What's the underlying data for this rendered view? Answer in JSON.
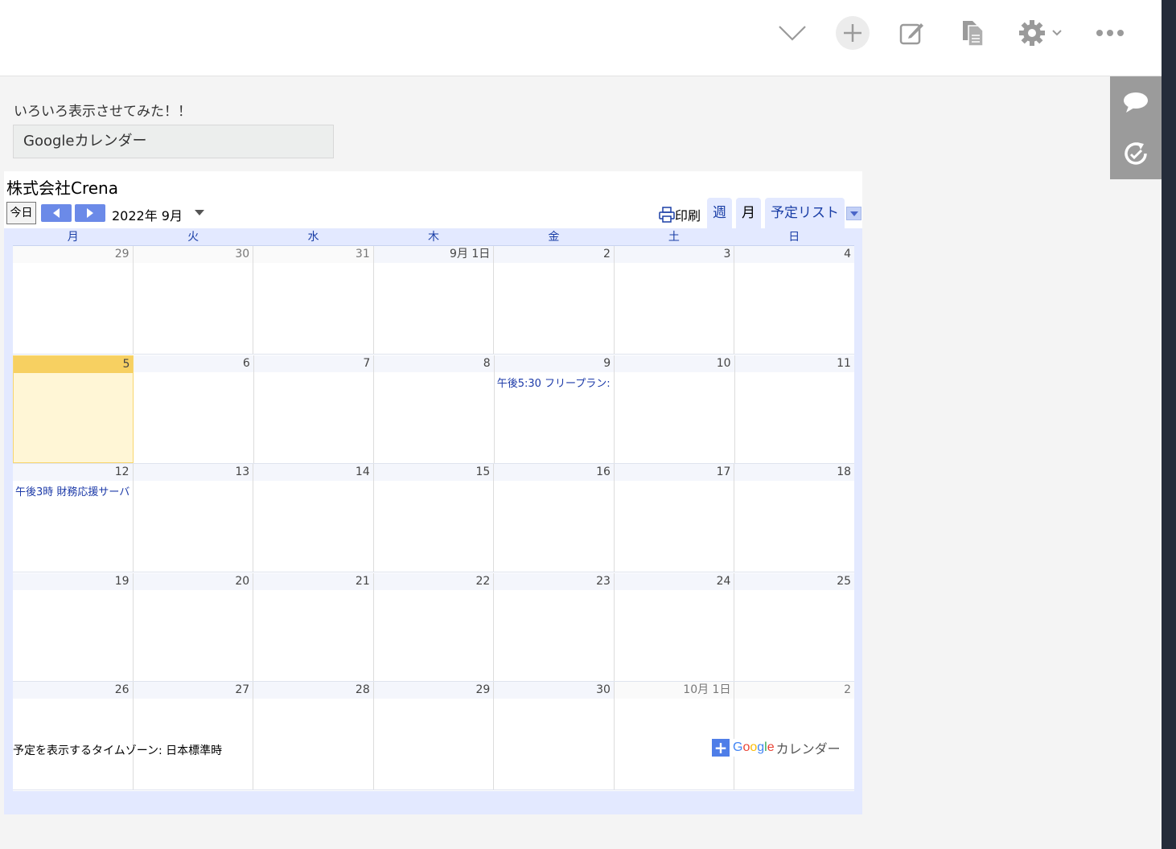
{
  "intro_text": "いろいろ表示させてみた！！",
  "label_box": "Googleカレンダー",
  "calendar": {
    "title": "株式会社Crena",
    "today_button": "今日",
    "month_label": "2022年 9月",
    "print_label": "印刷",
    "views": {
      "week": "週",
      "month": "月",
      "list": "予定リスト"
    },
    "weekdays": [
      "月",
      "火",
      "水",
      "木",
      "金",
      "土",
      "日"
    ],
    "weeks": [
      [
        {
          "label": "29",
          "other": true
        },
        {
          "label": "30",
          "other": true
        },
        {
          "label": "31",
          "other": true
        },
        {
          "label": "9月 1日",
          "other": false
        },
        {
          "label": "2",
          "other": false
        },
        {
          "label": "3",
          "other": false
        },
        {
          "label": "4",
          "other": false
        }
      ],
      [
        {
          "label": "5",
          "other": false,
          "today": true
        },
        {
          "label": "6",
          "other": false
        },
        {
          "label": "7",
          "other": false
        },
        {
          "label": "8",
          "other": false
        },
        {
          "label": "9",
          "other": false,
          "event": "午後5:30 フリープラン:"
        },
        {
          "label": "10",
          "other": false
        },
        {
          "label": "11",
          "other": false
        }
      ],
      [
        {
          "label": "12",
          "other": false,
          "event": "午後3時 財務応援サーバ"
        },
        {
          "label": "13",
          "other": false
        },
        {
          "label": "14",
          "other": false
        },
        {
          "label": "15",
          "other": false
        },
        {
          "label": "16",
          "other": false
        },
        {
          "label": "17",
          "other": false
        },
        {
          "label": "18",
          "other": false
        }
      ],
      [
        {
          "label": "19",
          "other": false
        },
        {
          "label": "20",
          "other": false
        },
        {
          "label": "21",
          "other": false
        },
        {
          "label": "22",
          "other": false
        },
        {
          "label": "23",
          "other": false
        },
        {
          "label": "24",
          "other": false
        },
        {
          "label": "25",
          "other": false
        }
      ],
      [
        {
          "label": "26",
          "other": false
        },
        {
          "label": "27",
          "other": false
        },
        {
          "label": "28",
          "other": false
        },
        {
          "label": "29",
          "other": false
        },
        {
          "label": "30",
          "other": false
        },
        {
          "label": "10月 1日",
          "other": true
        },
        {
          "label": "2",
          "other": true
        }
      ]
    ],
    "timezone_text": "予定を表示するタイムゾーン: 日本標準時",
    "badge": {
      "plus": "+",
      "google_letters": [
        {
          "ch": "G",
          "color": "#4285f4"
        },
        {
          "ch": "o",
          "color": "#ea4335"
        },
        {
          "ch": "o",
          "color": "#fbbc05"
        },
        {
          "ch": "g",
          "color": "#4285f4"
        },
        {
          "ch": "l",
          "color": "#34a853"
        },
        {
          "ch": "e",
          "color": "#ea4335"
        }
      ],
      "text": "カレンダー"
    }
  },
  "toolbar_icons": [
    "chevron-down-icon",
    "plus-icon",
    "edit-icon",
    "document-icon",
    "gear-icon",
    "more-icon"
  ],
  "side_icons": [
    "comment-icon",
    "history-icon"
  ],
  "colors": {
    "today_header": "#f7d061",
    "today_bg": "#fff6d6",
    "grid_bg": "#e3e9ff",
    "link_blue": "#1a3ea6"
  }
}
